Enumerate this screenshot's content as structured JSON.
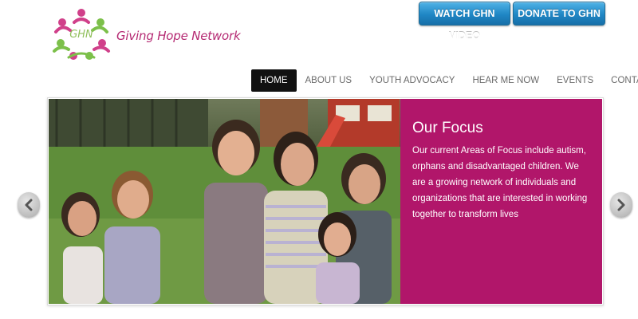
{
  "brand": {
    "logo_text": "GHN",
    "name": "Giving Hope Network",
    "accent": "#b52a73",
    "logo_green": "#7cc04a"
  },
  "header": {
    "video_button": "WATCH GHN VIDEO",
    "donate_button": "DONATE TO GHN",
    "button_color": "#1f86c4"
  },
  "nav": {
    "items": [
      {
        "label": "HOME",
        "active": true
      },
      {
        "label": "ABOUT US"
      },
      {
        "label": "YOUTH ADVOCACY"
      },
      {
        "label": "HEAR ME NOW"
      },
      {
        "label": "EVENTS"
      },
      {
        "label": "CONTACT US"
      }
    ]
  },
  "slider": {
    "title": "Our Focus",
    "body": "Our current Areas of Focus include autism, orphans and disadvantaged children. We are a growing network of individuals and organizations that are interested in working together to transform lives",
    "panel_color": "#b1166a",
    "prev_icon": "chevron-left-icon",
    "next_icon": "chevron-right-icon"
  }
}
